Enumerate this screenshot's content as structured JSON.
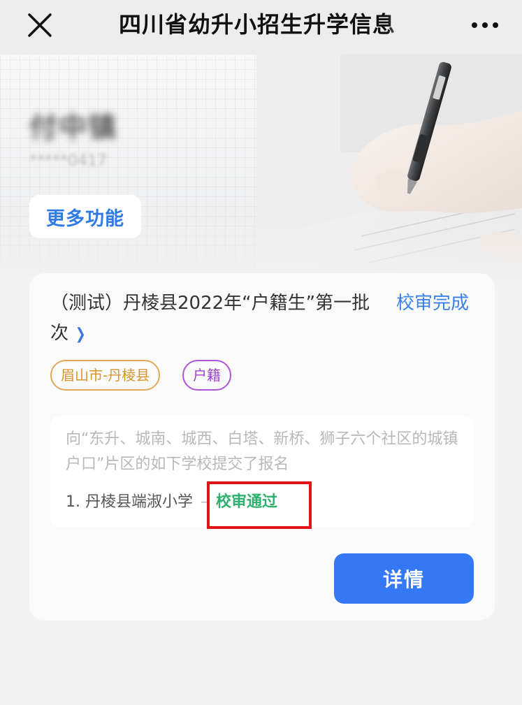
{
  "navbar": {
    "title": "四川省幼升小招生升学信息",
    "close_icon": "close-icon",
    "more_icon": "more-dots-icon"
  },
  "profile": {
    "name": "付中镇",
    "id_masked": "*****0417",
    "more_functions_label": "更多功能"
  },
  "batch": {
    "title": "（测试）丹棱县2022年“户籍生”第一批次",
    "status": "校审完成",
    "tags": [
      "眉山市-丹棱县",
      "户籍"
    ],
    "info_text": "向“东升、城南、城西、白塔、新桥、狮子六个社区的城镇户口”片区的如下学校提交了报名",
    "schools": [
      {
        "index": "1.",
        "name": "丹棱县端淑小学",
        "separator": "–",
        "status": "校审通过"
      }
    ],
    "detail_button_label": "详情"
  },
  "colors": {
    "primary_blue": "#3478f6",
    "status_blue": "#3b82e6",
    "pass_green": "#2fb06e",
    "region_tag": "#d9952e",
    "hukou_tag": "#a33fd1",
    "highlight_red": "#e11414"
  }
}
